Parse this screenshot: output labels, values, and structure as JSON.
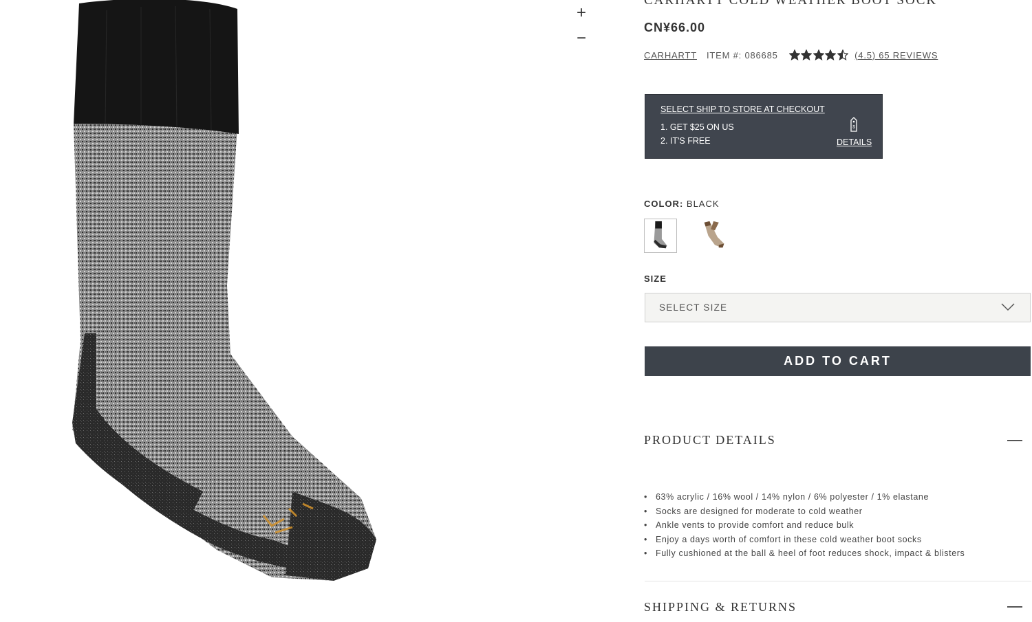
{
  "product": {
    "title": "CARHARTT COLD WEATHER BOOT SOCK",
    "price": "CN¥66.00",
    "brand": "CARHARTT",
    "item_number": "ITEM #: 086685",
    "rating_text": "(4.5) 65 REVIEWS",
    "rating": 4.5,
    "rating_max": 5
  },
  "zoom": {
    "plus": "+",
    "minus": "−"
  },
  "promo": {
    "headline": "SELECT SHIP TO STORE AT CHECKOUT",
    "line1": "1. GET $25 ON US",
    "line2": "2. IT'S FREE",
    "details": "DETAILS",
    "icon": "price-tag-icon"
  },
  "color": {
    "label": "COLOR:",
    "value": "BLACK",
    "swatches": [
      "black-sock",
      "brown-sock"
    ]
  },
  "size": {
    "label": "SIZE",
    "placeholder": "SELECT SIZE"
  },
  "cart": {
    "label": "ADD TO CART"
  },
  "product_details": {
    "title": "PRODUCT DETAILS",
    "bullets": [
      "63% acrylic / 16% wool / 14% nylon / 6% polyester / 1% elastane",
      "Socks are designed for moderate to cold weather",
      "Ankle vents to provide comfort and reduce bulk",
      "Enjoy a days worth of comfort in these cold weather boot socks",
      "Fully cushioned at the ball & heel of foot reduces shock, impact & blisters"
    ]
  },
  "shipping": {
    "title": "SHIPPING & RETURNS"
  },
  "colors": {
    "dark_button": "#3d434b",
    "promo_bg": "#40454e",
    "text": "#333333"
  }
}
